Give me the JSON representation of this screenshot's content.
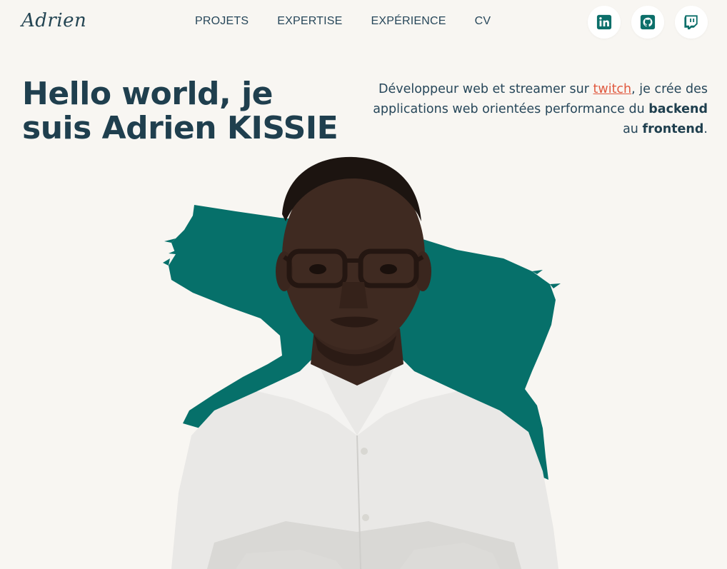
{
  "header": {
    "logo": "Adrien",
    "nav": [
      "PROJETS",
      "EXPERTISE",
      "EXPÉRIENCE",
      "CV"
    ],
    "socials": [
      {
        "name": "linkedin-icon"
      },
      {
        "name": "github-icon"
      },
      {
        "name": "twitch-icon"
      }
    ]
  },
  "hero": {
    "title_line1": "Hello world, je",
    "title_line2": "suis Adrien KISSIE",
    "intro_part1": "Développeur web et streamer sur ",
    "intro_link": "twitch",
    "intro_part2": ", je crée des applications web orientées performance du ",
    "intro_bold1": "backend",
    "intro_part3": " au ",
    "intro_bold2": "frontend",
    "intro_part4": "."
  },
  "colors": {
    "background": "#f8f6f2",
    "text": "#1f3f4e",
    "accent": "#e0593f",
    "brush": "#06706a",
    "icon": "#0c6f6a"
  }
}
